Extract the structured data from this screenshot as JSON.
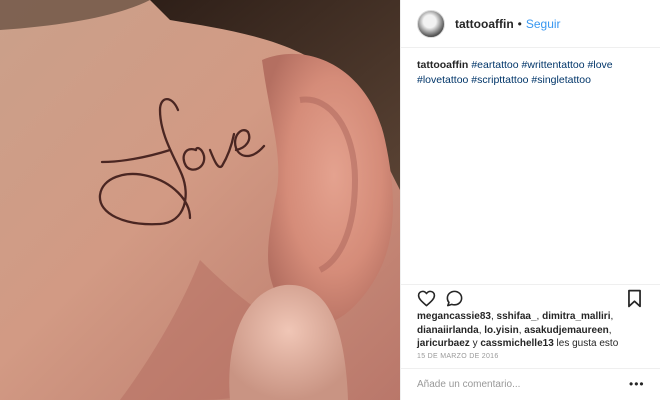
{
  "post": {
    "photo": {
      "description_icon": "photo",
      "tattoo_text": "love"
    },
    "header": {
      "username": "tattooaffin",
      "separator": "•",
      "follow_label": "Seguir"
    },
    "caption": {
      "username": "tattooaffin",
      "hashtags": [
        "#eartattoo",
        "#writtentattoo",
        "#love",
        "#lovetattoo",
        "#scripttattoo",
        "#singletattoo"
      ]
    },
    "actions": {
      "like_icon": "heart-icon",
      "comment_icon": "comment-icon",
      "save_icon": "bookmark-icon"
    },
    "likes": {
      "users": [
        "megancassie83",
        "sshifaa_",
        "dimitra_malliri",
        "dianaiirlanda",
        "lo.yisin",
        "asakudjemaureen",
        "jaricurbaez"
      ],
      "conjunction": "y",
      "last_user": "cassmichelle13",
      "suffix": "les gusta esto"
    },
    "date": "15 DE MARZO DE 2016",
    "comment": {
      "placeholder": "Añade un comentario...",
      "more_label": "•••"
    }
  }
}
